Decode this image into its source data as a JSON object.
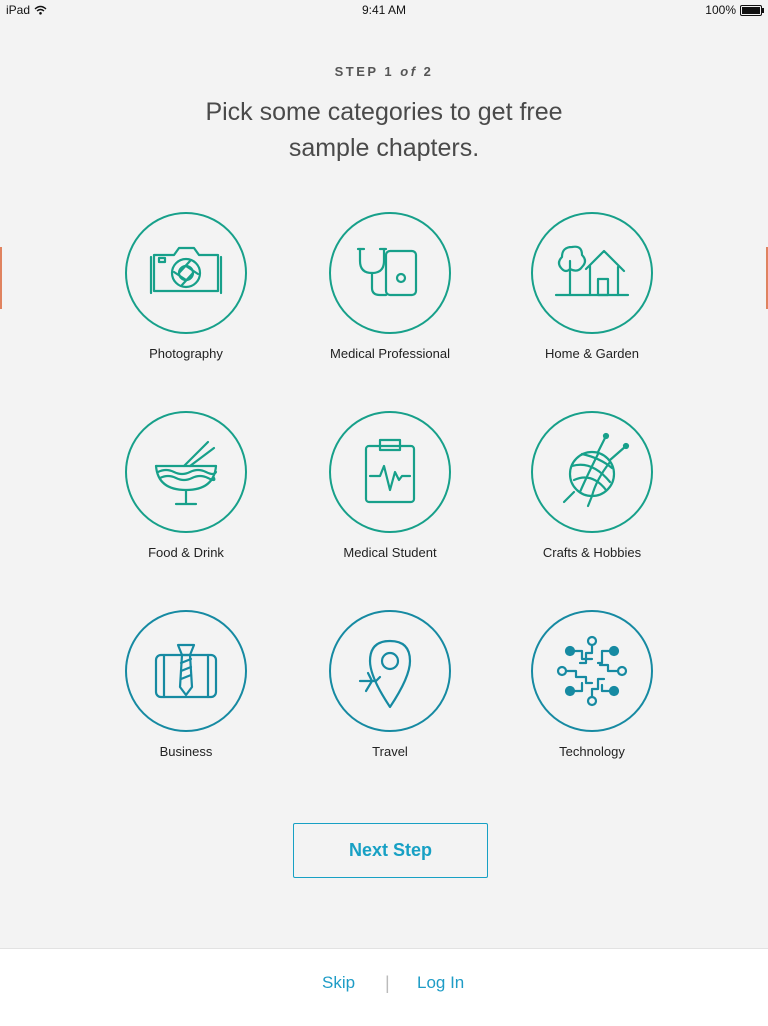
{
  "status_bar": {
    "device": "iPad",
    "time": "9:41 AM",
    "battery": "100%"
  },
  "header": {
    "step_prefix": "STEP 1",
    "step_of": "of",
    "step_total": "2",
    "headline": "Pick some categories to get free sample chapters."
  },
  "categories": [
    {
      "label": "Photography",
      "icon": "camera-icon"
    },
    {
      "label": "Medical Professional",
      "icon": "stethoscope-icon"
    },
    {
      "label": "Home & Garden",
      "icon": "house-tree-icon"
    },
    {
      "label": "Food & Drink",
      "icon": "noodle-bowl-icon"
    },
    {
      "label": "Medical Student",
      "icon": "clipboard-heartbeat-icon"
    },
    {
      "label": "Crafts & Hobbies",
      "icon": "yarn-ball-icon"
    },
    {
      "label": "Business",
      "icon": "briefcase-tie-icon"
    },
    {
      "label": "Travel",
      "icon": "map-pin-plane-icon"
    },
    {
      "label": "Technology",
      "icon": "circuit-icon"
    }
  ],
  "actions": {
    "next_step": "Next Step"
  },
  "footer": {
    "skip": "Skip",
    "separator": "|",
    "login": "Log In"
  },
  "colors": {
    "teal": "#17a08a",
    "blue": "#168aa2",
    "link": "#1e9cc6",
    "background": "#f3f3f3"
  }
}
